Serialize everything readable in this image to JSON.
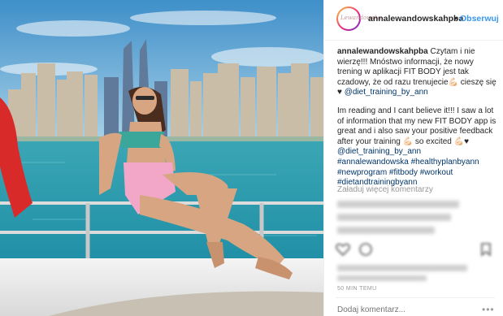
{
  "header": {
    "avatar_text": "Lewandowska",
    "username": "annalewandowskahpba",
    "separator": "•",
    "follow_label": "Obserwuj"
  },
  "caption": {
    "username": "annalewandowskahpba",
    "polish_text": "Czytam i nie wierzę!!! Mnóstwo informacji, że nowy trening w aplikacji FIT BODY jest tak czadowy, że od razu trenujecie💪🏻 cieszę się ♥",
    "polish_tag": "@diet_training_by_ann",
    "english_text": "Im reading and I cant believe it!!! I saw a lot of information that my new FIT BODY app is great and i also saw your positive feedback after your training 💪🏻 so excited 💪🏻♥",
    "english_tag": "@diet_training_by_ann",
    "hashtags": "#annalewandowska #healthyplanbyann #newprogram #fitbody #workout #dietandtrainingbyann"
  },
  "load_more_label": "Załaduj więcej komentarzy",
  "timestamp": "50 MIN TEMU",
  "comment_placeholder": "Dodaj komentarz...",
  "more_options": "•••",
  "icons": [
    "heart-icon",
    "comment-icon",
    "save-icon"
  ]
}
